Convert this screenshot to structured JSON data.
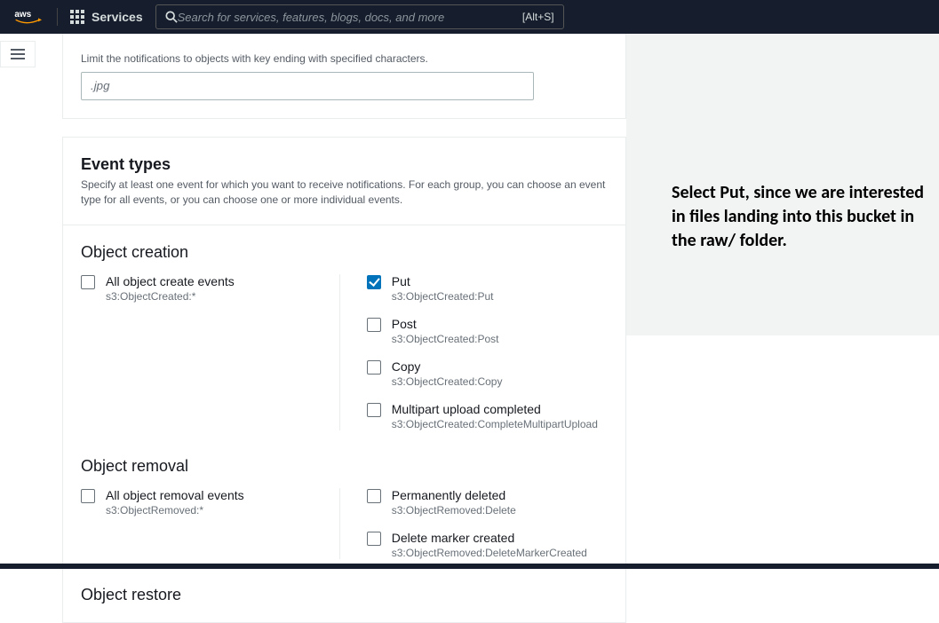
{
  "nav": {
    "services_label": "Services",
    "search_placeholder": "Search for services, features, blogs, docs, and more",
    "shortcut": "[Alt+S]"
  },
  "suffix": {
    "desc": "Limit the notifications to objects with key ending with specified characters.",
    "placeholder": ".jpg"
  },
  "event_types": {
    "title": "Event types",
    "desc": "Specify at least one event for which you want to receive notifications. For each group, you can choose an event type for all events, or you can choose one or more individual events."
  },
  "creation": {
    "title": "Object creation",
    "all": {
      "label": "All object create events",
      "api": "s3:ObjectCreated:*"
    },
    "put": {
      "label": "Put",
      "api": "s3:ObjectCreated:Put"
    },
    "post": {
      "label": "Post",
      "api": "s3:ObjectCreated:Post"
    },
    "copy": {
      "label": "Copy",
      "api": "s3:ObjectCreated:Copy"
    },
    "multipart": {
      "label": "Multipart upload completed",
      "api": "s3:ObjectCreated:CompleteMultipartUpload"
    }
  },
  "removal": {
    "title": "Object removal",
    "all": {
      "label": "All object removal events",
      "api": "s3:ObjectRemoved:*"
    },
    "perm": {
      "label": "Permanently deleted",
      "api": "s3:ObjectRemoved:Delete"
    },
    "marker": {
      "label": "Delete marker created",
      "api": "s3:ObjectRemoved:DeleteMarkerCreated"
    }
  },
  "restore": {
    "title": "Object restore"
  },
  "annotation": "Select Put, since we are interested in files landing into this bucket in the raw/ folder."
}
